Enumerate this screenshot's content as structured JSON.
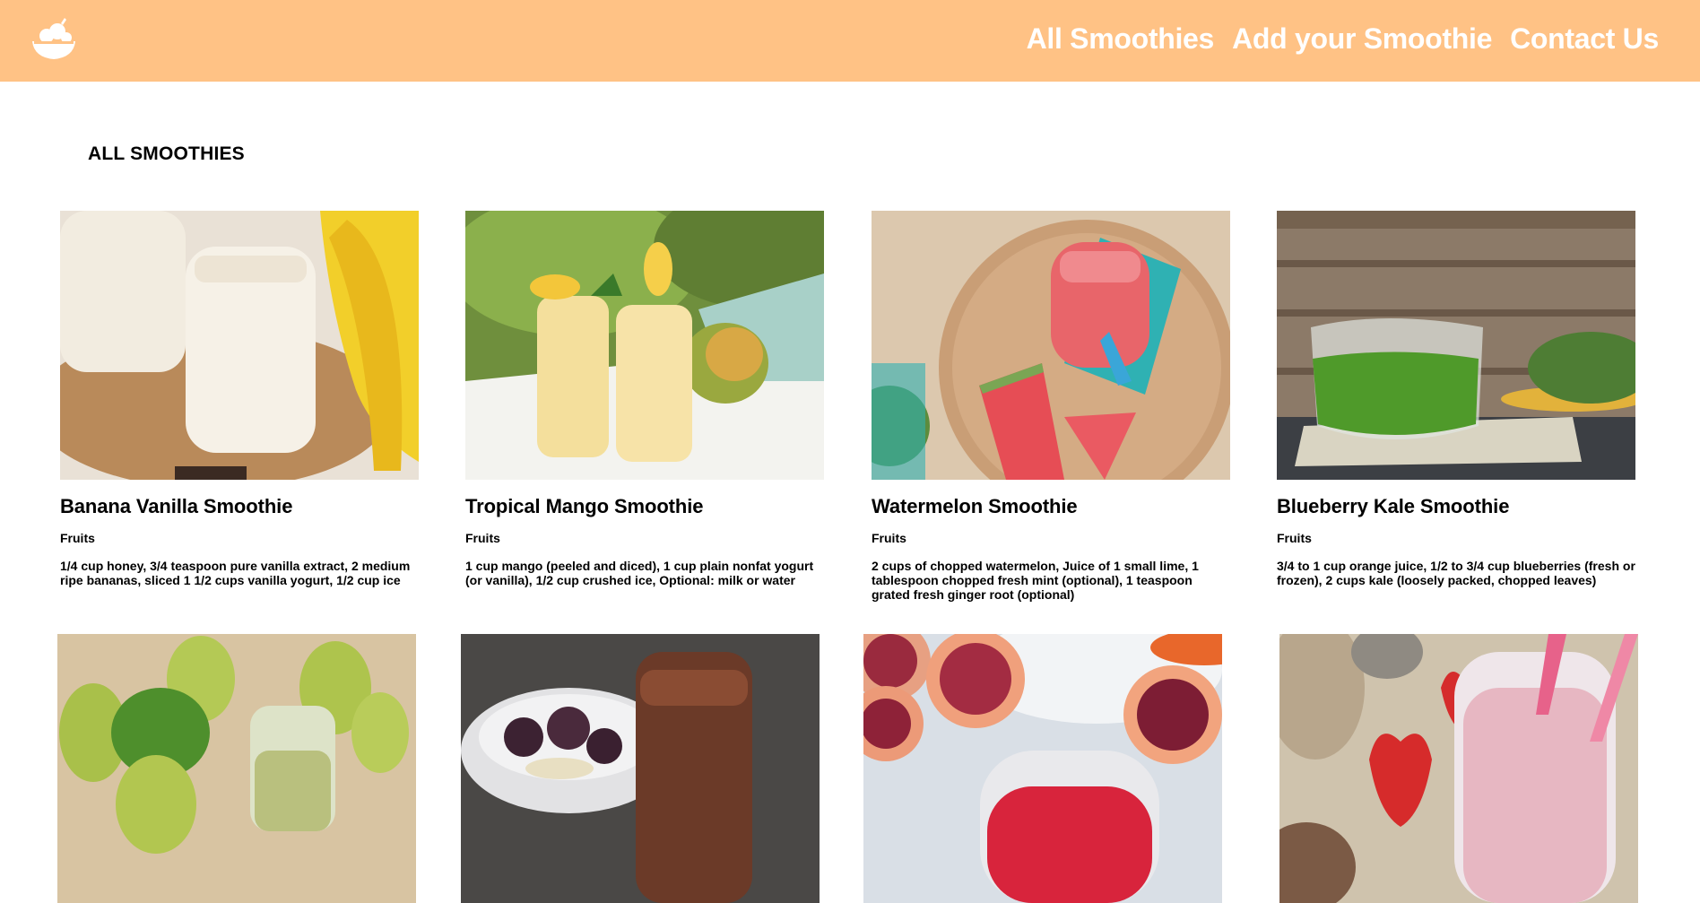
{
  "header": {
    "logo_icon": "fruit-bowl-icon",
    "background": "#ffc285",
    "nav": [
      {
        "label": "All Smoothies"
      },
      {
        "label": "Add your Smoothie"
      },
      {
        "label": "Contact Us"
      }
    ]
  },
  "main": {
    "title": "ALL SMOOTHIES",
    "smoothies": [
      {
        "name": "Banana Vanilla Smoothie",
        "category": "Fruits",
        "ingredients": "1/4 cup honey, 3/4 teaspoon pure vanilla extract, 2 medium ripe bananas, sliced 1 1/2 cups vanilla yogurt, 1/2 cup ice"
      },
      {
        "name": "Tropical Mango Smoothie",
        "category": "Fruits",
        "ingredients": "1 cup mango (peeled and diced), 1 cup plain nonfat yogurt (or vanilla), 1/2 cup crushed ice, Optional: milk or water"
      },
      {
        "name": "Watermelon Smoothie",
        "category": "Fruits",
        "ingredients": "2 cups of chopped watermelon, Juice of 1 small lime, 1 tablespoon chopped fresh mint (optional), 1 teaspoon grated fresh ginger root (optional)"
      },
      {
        "name": "Blueberry Kale Smoothie",
        "category": "Fruits",
        "ingredients": "3/4 to 1 cup orange juice, 1/2 to 3/4 cup blueberries (fresh or frozen), 2 cups kale (loosely packed, chopped leaves)"
      }
    ]
  }
}
